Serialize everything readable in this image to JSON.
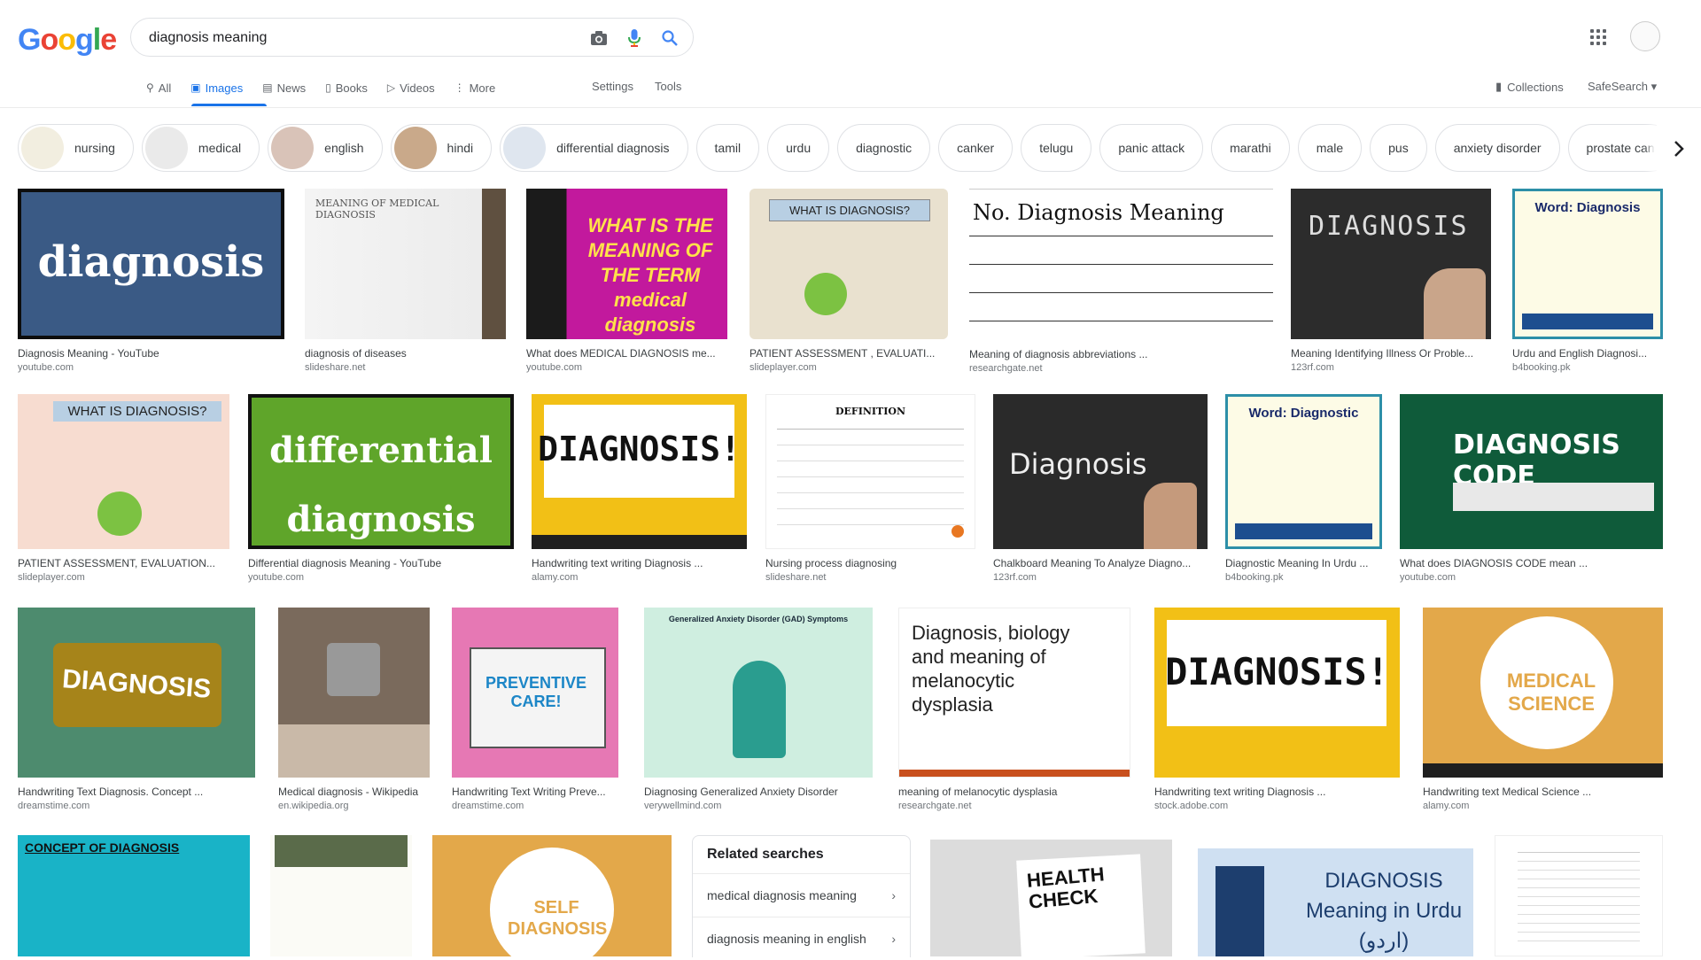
{
  "header": {
    "logo": "Google",
    "search_value": "diagnosis meaning",
    "colors": {
      "blue": "#4285f4",
      "red": "#ea4335",
      "yellow": "#fbbc05",
      "green": "#34a853",
      "accent": "#1a73e8"
    }
  },
  "tabs": [
    {
      "label": "All",
      "icon": "search-icon"
    },
    {
      "label": "Images",
      "icon": "image-icon"
    },
    {
      "label": "News",
      "icon": "news-icon"
    },
    {
      "label": "Books",
      "icon": "book-icon"
    },
    {
      "label": "Videos",
      "icon": "video-icon"
    },
    {
      "label": "More",
      "icon": "more-vert-icon"
    }
  ],
  "nav": {
    "settings": "Settings",
    "tools": "Tools",
    "collections": "Collections",
    "safesearch": "SafeSearch"
  },
  "chips": [
    "nursing",
    "medical",
    "english",
    "hindi",
    "differential diagnosis",
    "tamil",
    "urdu",
    "diagnostic",
    "canker",
    "telugu",
    "panic attack",
    "marathi",
    "male",
    "pus",
    "anxiety disorder",
    "prostate can"
  ],
  "results": [
    {
      "caption": "Diagnosis Meaning - YouTube",
      "source": "youtube.com",
      "overlay": "diagnosis"
    },
    {
      "caption": "diagnosis of diseases",
      "source": "slideshare.net",
      "overlay": "MEANING OF MEDICAL DIAGNOSIS"
    },
    {
      "caption": "What does MEDICAL DIAGNOSIS me...",
      "source": "youtube.com",
      "overlay": "WHAT IS THE MEANING OF THE TERM medical diagnosis"
    },
    {
      "caption": "PATIENT ASSESSMENT , EVALUATI...",
      "source": "slideplayer.com",
      "overlay": "WHAT IS DIAGNOSIS?"
    },
    {
      "caption": "Meaning of diagnosis abbreviations ...",
      "source": "researchgate.net",
      "overlay": "No. Diagnosis Meaning"
    },
    {
      "caption": "Meaning Identifying Illness Or Proble...",
      "source": "123rf.com",
      "overlay": "DIAGNOSIS"
    },
    {
      "caption": "Urdu and English Diagnosi...",
      "source": "b4booking.pk",
      "overlay": "Word: Diagnosis"
    },
    {
      "caption": "PATIENT ASSESSMENT, EVALUATION...",
      "source": "slideplayer.com",
      "overlay": "WHAT IS DIAGNOSIS?"
    },
    {
      "caption": "Differential diagnosis Meaning - YouTube",
      "source": "youtube.com",
      "overlay": "differential diagnosis"
    },
    {
      "caption": "Handwriting text writing Diagnosis ...",
      "source": "alamy.com",
      "overlay": "DIAGNOSIS!"
    },
    {
      "caption": "Nursing process diagnosing",
      "source": "slideshare.net",
      "overlay": "DEFINITION"
    },
    {
      "caption": "Chalkboard Meaning To Analyze Diagno...",
      "source": "123rf.com",
      "overlay": "Diagnosis"
    },
    {
      "caption": "Diagnostic Meaning In Urdu ...",
      "source": "b4booking.pk",
      "overlay": "Word: Diagnostic"
    },
    {
      "caption": "What does DIAGNOSIS CODE mean ...",
      "source": "youtube.com",
      "overlay": "DIAGNOSIS CODE"
    },
    {
      "caption": "Handwriting Text Diagnosis. Concept ...",
      "source": "dreamstime.com",
      "overlay": "DIAGNOSIS"
    },
    {
      "caption": "Medical diagnosis - Wikipedia",
      "source": "en.wikipedia.org",
      "overlay": ""
    },
    {
      "caption": "Handwriting Text Writing Preve...",
      "source": "dreamstime.com",
      "overlay": "PREVENTIVE CARE!"
    },
    {
      "caption": "Diagnosing Generalized Anxiety Disorder",
      "source": "verywellmind.com",
      "overlay": "Generalized Anxiety Disorder (GAD) Symptoms"
    },
    {
      "caption": "meaning of melanocytic dysplasia",
      "source": "researchgate.net",
      "overlay": "Diagnosis, biology and meaning of melanocytic dysplasia"
    },
    {
      "caption": "Handwriting text writing Diagnosis ...",
      "source": "stock.adobe.com",
      "overlay": "DIAGNOSIS!"
    },
    {
      "caption": "Handwriting text Medical Science ...",
      "source": "alamy.com",
      "overlay": "MEDICAL SCIENCE"
    },
    {
      "caption": "",
      "source": "",
      "overlay": "CONCEPT OF DIAGNOSIS"
    },
    {
      "caption": "",
      "source": "",
      "overlay": ""
    },
    {
      "caption": "",
      "source": "",
      "overlay": "SELF DIAGNOSIS"
    },
    {
      "caption": "",
      "source": "",
      "overlay": "HEALTH CHECK"
    },
    {
      "caption": "",
      "source": "",
      "overlay": "DIAGNOSIS Meaning in Urdu (اردو)"
    },
    {
      "caption": "",
      "source": "",
      "overlay": ""
    }
  ],
  "related": {
    "title": "Related searches",
    "items": [
      "medical diagnosis meaning",
      "diagnosis meaning in english"
    ]
  }
}
